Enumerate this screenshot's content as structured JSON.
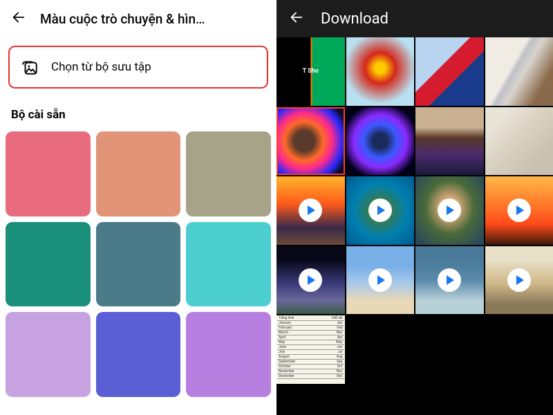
{
  "left": {
    "title": "Màu cuộc trò chuyện & hìn…",
    "gallery_label": "Chọn từ bộ sưu tập",
    "section_title": "Bộ cài sẵn",
    "colors": [
      "#e86b7e",
      "#e29478",
      "#a6a388",
      "#1a8f7a",
      "#4b7a88",
      "#4ecfcf",
      "#c6a3e0",
      "#5a5fd6",
      "#b77fe0"
    ]
  },
  "right": {
    "title": "Download",
    "shop_text": "T Sho",
    "items": [
      {
        "class": "g-shop",
        "video": false,
        "selected": false
      },
      {
        "class": "g-ironman",
        "video": false,
        "selected": false
      },
      {
        "class": "g-spidey",
        "video": false,
        "selected": false
      },
      {
        "class": "g-knife",
        "video": false,
        "selected": false
      },
      {
        "class": "g-cat",
        "video": false,
        "selected": true
      },
      {
        "class": "g-panther",
        "video": false,
        "selected": false
      },
      {
        "class": "g-messi",
        "video": false,
        "selected": false
      },
      {
        "class": "g-paper",
        "video": false,
        "selected": false
      },
      {
        "class": "g-sunset",
        "video": true,
        "selected": false
      },
      {
        "class": "g-island",
        "video": true,
        "selected": false
      },
      {
        "class": "g-mushroom",
        "video": true,
        "selected": false
      },
      {
        "class": "g-orange",
        "video": true,
        "selected": false
      },
      {
        "class": "g-flowers",
        "video": true,
        "selected": false
      },
      {
        "class": "g-beach",
        "video": true,
        "selected": false
      },
      {
        "class": "g-wave",
        "video": true,
        "selected": false
      },
      {
        "class": "g-safari",
        "video": true,
        "selected": false
      },
      {
        "class": "g-sheet",
        "video": false,
        "selected": false
      }
    ],
    "sheet_rows": [
      [
        "Tiếng Anh",
        "Viết tắt"
      ],
      [
        "January",
        "Jan"
      ],
      [
        "February",
        "Feb"
      ],
      [
        "March",
        "Mar"
      ],
      [
        "April",
        "Apr"
      ],
      [
        "May",
        "May"
      ],
      [
        "June",
        "Jun"
      ],
      [
        "July",
        "Jul"
      ],
      [
        "August",
        "Aug"
      ],
      [
        "September",
        "Sep"
      ],
      [
        "October",
        "Oct"
      ],
      [
        "November",
        "Nov"
      ],
      [
        "December",
        "Dec"
      ]
    ]
  }
}
